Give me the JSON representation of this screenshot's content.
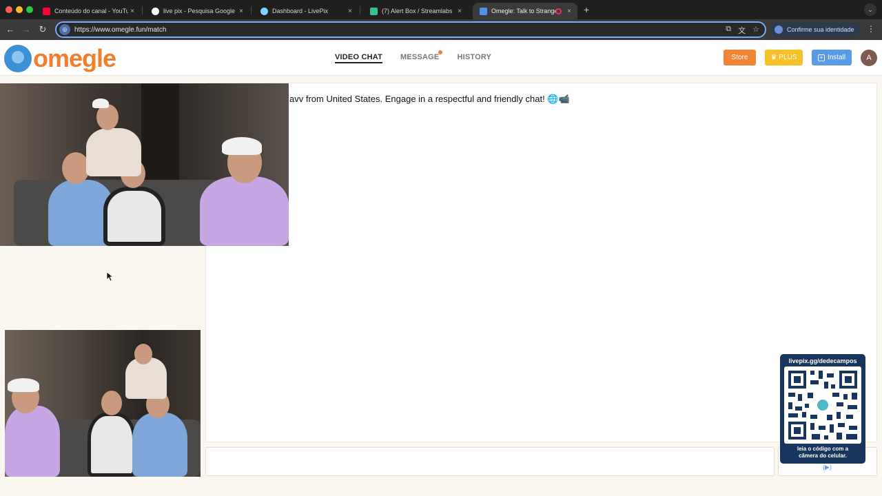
{
  "browser": {
    "tabs": [
      {
        "label": "Conteúdo do canal - YouTube",
        "favicon_color": "#ff0033",
        "active": false
      },
      {
        "label": "live pix - Pesquisa Google",
        "favicon_color": "#ffffff",
        "active": false
      },
      {
        "label": "Dashboard - LivePix",
        "favicon_color": "#7fd4ff",
        "active": false
      },
      {
        "label": "(7) Alert Box / Streamlabs",
        "favicon_color": "#31c48d",
        "active": false
      },
      {
        "label": "Omegle: Talk to Strangers",
        "favicon_color": "#4d94e8",
        "active": true
      }
    ],
    "close_glyph": "×",
    "new_tab_glyph": "+",
    "url": "https://www.omegle.fun/match",
    "identity_label": "Confirme sua identidade",
    "profile_initial": "A"
  },
  "site": {
    "logo_text": "omegle",
    "nav": [
      {
        "label": "VIDEO CHAT",
        "active": true
      },
      {
        "label": "MESSAGE",
        "active": false,
        "notification": true
      },
      {
        "label": "HISTORY",
        "active": false
      }
    ],
    "buttons": {
      "store": "Store",
      "plus": "PLUS",
      "install": "Install"
    },
    "avatar_initial": "A",
    "colors": {
      "brand_orange": "#f07f2d",
      "brand_blue": "#3d8fd6",
      "plus_yellow": "#f6c027",
      "install_blue": "#5a9be6"
    }
  },
  "chat": {
    "message": "avv from United States. Engage in a respectful and friendly chat! 🌐📹"
  },
  "qr_card": {
    "header": "livepix.gg/dedecampos",
    "footer_line1": "leia o código com a",
    "footer_line2": "câmera do celular."
  }
}
